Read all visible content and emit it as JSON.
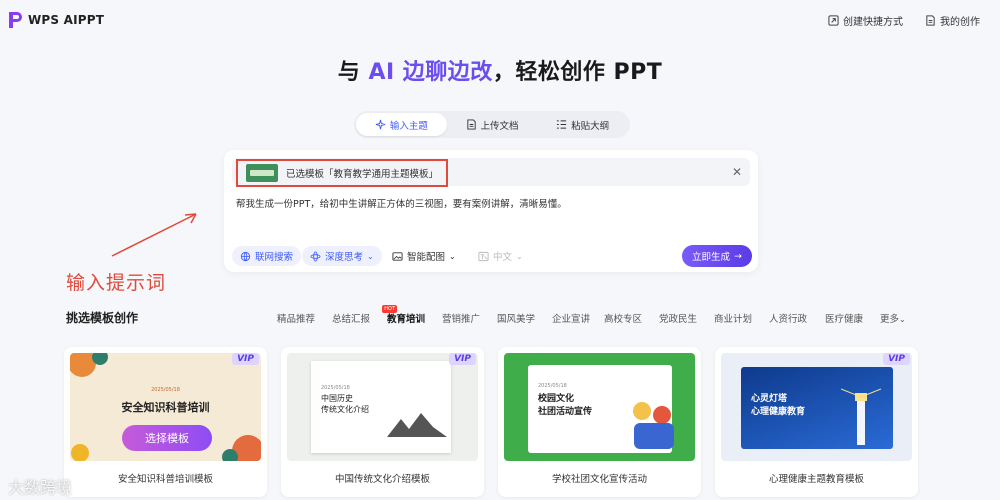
{
  "app": {
    "logo_text": "WPS AIPPT"
  },
  "topnav": [
    {
      "label": "创建快捷方式",
      "icon": "shortcut-icon"
    },
    {
      "label": "我的创作",
      "icon": "document-icon"
    }
  ],
  "headline": {
    "part1": "与 ",
    "accent": "AI 边聊边改",
    "part2": "，轻松创作 PPT"
  },
  "mode_tabs": [
    {
      "label": "输入主题",
      "icon": "sparkle-icon",
      "active": true
    },
    {
      "label": "上传文档",
      "icon": "file-icon",
      "active": false
    },
    {
      "label": "粘贴大纲",
      "icon": "outline-icon",
      "active": false
    }
  ],
  "prompt": {
    "selected_template_label": "已选模板「教育教学通用主题模板」",
    "text": "帮我生成一份PPT，给初中生讲解正方体的三视图，要有案例讲解，清晰易懂。",
    "web_search": "联网搜索",
    "deep_think": "深度思考",
    "smart_image": "智能配图",
    "language": "中文",
    "generate": "立即生成"
  },
  "annotation": "输入提示词",
  "templates_section": {
    "title": "挑选模板创作",
    "categories": [
      "精品推荐",
      "总结汇报",
      "教育培训",
      "营销推广",
      "国风美学",
      "企业宣讲",
      "高校专区",
      "党政民生",
      "商业计划",
      "人资行政",
      "医疗健康",
      "更多"
    ],
    "active_category": "教育培训",
    "hot_badge": "HOT",
    "select_button": "选择模板",
    "vip": "VIP"
  },
  "cards": [
    {
      "label": "安全知识科普培训模板",
      "thumb_title": "安全知识科普培训",
      "thumb_date": "2025/05/18",
      "bg": "#f5ead6"
    },
    {
      "label": "中国传统文化介绍模板",
      "thumb_title": "中国历史\n传统文化介绍",
      "thumb_date": "2025/05/18",
      "bg": "#ffffff"
    },
    {
      "label": "学校社团文化宣传活动",
      "thumb_title": "校园文化\n社团活动宣传",
      "thumb_date": "2025/05/18",
      "bg": "#3fae4a"
    },
    {
      "label": "心理健康主题教育模板",
      "thumb_title": "心灵灯塔\n心理健康教育",
      "thumb_date": "",
      "bg": "#1b4fb8"
    }
  ],
  "watermark": "大数跨境",
  "colors": {
    "accent": "#6b4df0",
    "annotation": "#e14a3b",
    "tab_active": "#3d5afe"
  }
}
